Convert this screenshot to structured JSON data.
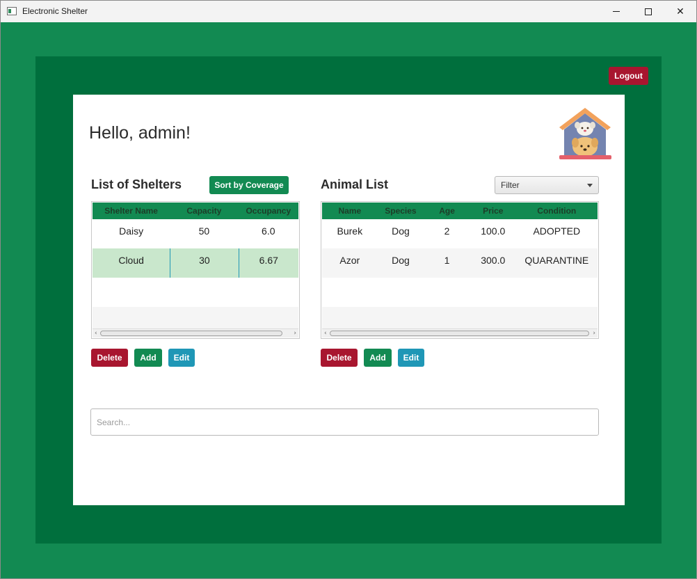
{
  "window": {
    "title": "Electronic Shelter"
  },
  "header": {
    "greeting": "Hello, admin!",
    "logout_label": "Logout"
  },
  "shelters": {
    "title": "List of Shelters",
    "sort_label": "Sort by Coverage",
    "columns": [
      "Shelter Name",
      "Capacity",
      "Occupancy"
    ],
    "rows": [
      [
        "Daisy",
        "50",
        "6.0"
      ],
      [
        "Cloud",
        "30",
        "6.67"
      ]
    ],
    "selected_row": 1,
    "actions": {
      "delete": "Delete",
      "add": "Add",
      "edit": "Edit"
    }
  },
  "animals": {
    "title": "Animal List",
    "filter_value": "Filter",
    "columns": [
      "Name",
      "Species",
      "Age",
      "Price",
      "Condition"
    ],
    "rows": [
      [
        "Burek",
        "Dog",
        "2",
        "100.0",
        "ADOPTED"
      ],
      [
        "Azor",
        "Dog",
        "1",
        "300.0",
        "QUARANTINE"
      ]
    ],
    "actions": {
      "delete": "Delete",
      "add": "Add",
      "edit": "Edit"
    }
  },
  "search": {
    "placeholder": "Search..."
  },
  "colors": {
    "background": "#128a52",
    "panel": "#006f3d",
    "danger": "#a8162f",
    "success": "#128a52",
    "info": "#1f97b6",
    "selected_row": "#c9e7cc"
  },
  "icons": {
    "logo": "dog-house-icon"
  }
}
